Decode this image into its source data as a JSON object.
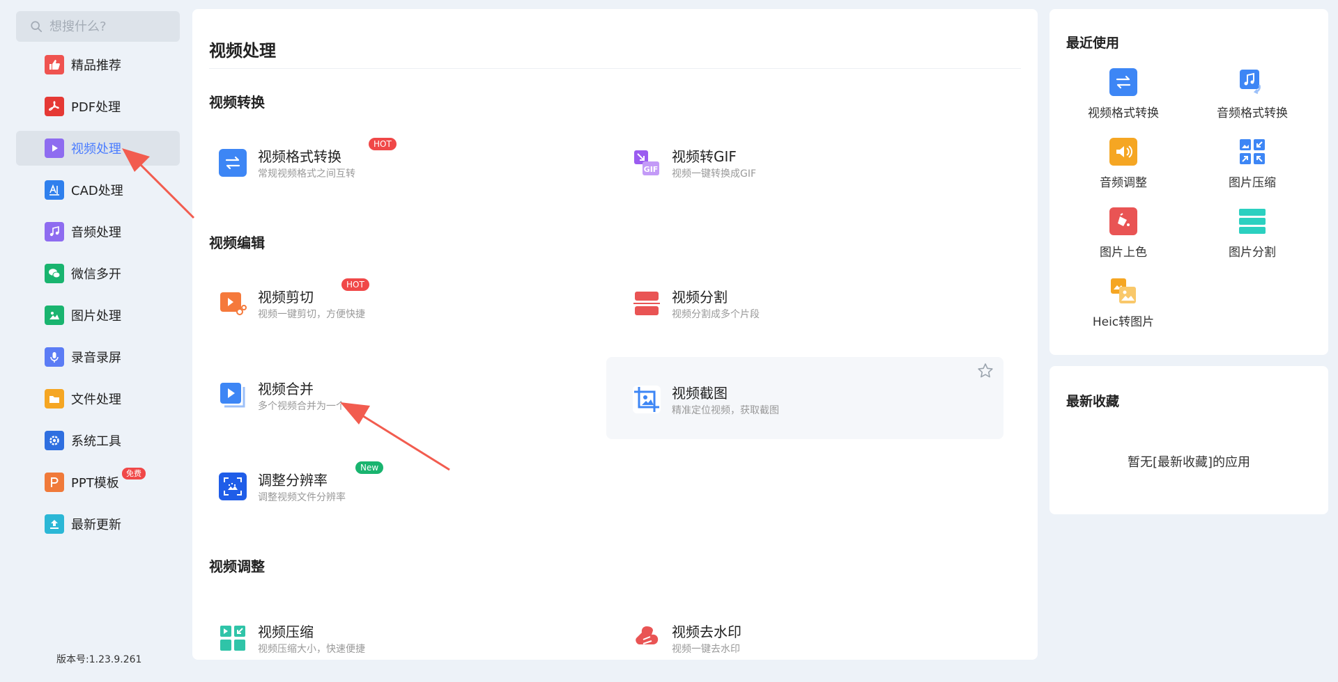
{
  "search": {
    "placeholder": "想搜什么?"
  },
  "sidebar": {
    "items": [
      {
        "label": "精品推荐",
        "icon": "thumbs-up-icon",
        "color": "#ef5350"
      },
      {
        "label": "PDF处理",
        "icon": "pdf-icon",
        "color": "#e53935"
      },
      {
        "label": "视频处理",
        "icon": "play-icon",
        "color": "#8e6cf0",
        "active": true
      },
      {
        "label": "CAD处理",
        "icon": "cad-icon",
        "color": "#2f80ed"
      },
      {
        "label": "音频处理",
        "icon": "music-icon",
        "color": "#8e6cf0"
      },
      {
        "label": "微信多开",
        "icon": "wechat-icon",
        "color": "#19b46f"
      },
      {
        "label": "图片处理",
        "icon": "image-icon",
        "color": "#19b46f"
      },
      {
        "label": "录音录屏",
        "icon": "microphone-icon",
        "color": "#5b7cf5"
      },
      {
        "label": "文件处理",
        "icon": "folder-icon",
        "color": "#f5a623"
      },
      {
        "label": "系统工具",
        "icon": "gear-icon",
        "color": "#2f6fe0"
      },
      {
        "label": "PPT模板",
        "icon": "ppt-icon",
        "color": "#f07a3a",
        "badge": "免费"
      },
      {
        "label": "最新更新",
        "icon": "upload-icon",
        "color": "#2bb7d6"
      }
    ],
    "version": "版本号:1.23.9.261"
  },
  "main": {
    "title": "视频处理",
    "sections": [
      {
        "title": "视频转换"
      },
      {
        "title": "视频编辑"
      },
      {
        "title": "视频调整"
      }
    ],
    "tools": [
      {
        "title": "视频格式转换",
        "desc": "常规视频格式之间互转",
        "badge": "HOT",
        "icon": "swap-arrows-icon",
        "color": "#3d86f5"
      },
      {
        "title": "视频转GIF",
        "desc": "视频一键转换成GIF",
        "icon": "gif-icon",
        "color": "#9b5cf0"
      },
      {
        "title": "视频剪切",
        "desc": "视频一键剪切，方便快捷",
        "badge": "HOT",
        "icon": "scissors-icon",
        "color": "#f5793b"
      },
      {
        "title": "视频分割",
        "desc": "视频分割成多个片段",
        "icon": "split-icon",
        "color": "#e95454"
      },
      {
        "title": "视频合并",
        "desc": "多个视频合并为一个",
        "icon": "merge-icon",
        "color": "#3d86f5"
      },
      {
        "title": "视频截图",
        "desc": "精准定位视频，获取截图",
        "icon": "crop-icon",
        "color": "#3d86f5"
      },
      {
        "title": "调整分辨率",
        "desc": "调整视频文件分辨率",
        "badge": "New",
        "icon": "resolution-icon",
        "color": "#1f5de8"
      },
      {
        "title": "视频压缩",
        "desc": "视频压缩大小，快速便捷",
        "icon": "compress-icon",
        "color": "#2fc4a8"
      },
      {
        "title": "视频去水印",
        "desc": "视频一键去水印",
        "icon": "watermark-icon",
        "color": "#e95454"
      }
    ]
  },
  "recent": {
    "title": "最近使用",
    "items": [
      {
        "label": "视频格式转换",
        "icon": "swap-arrows-icon",
        "color": "#3d86f5"
      },
      {
        "label": "音频格式转换",
        "icon": "music-convert-icon",
        "color": "#3d86f5"
      },
      {
        "label": "音频调整",
        "icon": "speaker-icon",
        "color": "#f5a623"
      },
      {
        "label": "图片压缩",
        "icon": "image-compress-icon",
        "color": "#3d86f5"
      },
      {
        "label": "图片上色",
        "icon": "paint-bucket-icon",
        "color": "#e95454"
      },
      {
        "label": "图片分割",
        "icon": "image-split-icon",
        "color": "#2bd0c0"
      },
      {
        "label": "Heic转图片",
        "icon": "heic-icon",
        "color": "#f5a623"
      }
    ]
  },
  "favorites": {
    "title": "最新收藏",
    "empty": "暂无[最新收藏]的应用"
  }
}
